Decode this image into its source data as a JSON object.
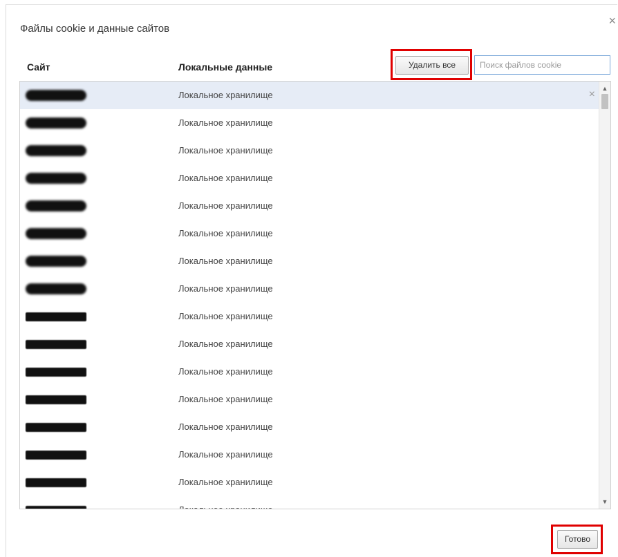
{
  "dialog": {
    "title": "Файлы cookie и данные сайтов",
    "close_glyph": "×"
  },
  "columns": {
    "site": "Сайт",
    "local_data": "Локальные данные"
  },
  "toolbar": {
    "delete_all_label": "Удалить все",
    "search_placeholder": "Поиск файлов cookie"
  },
  "rows": [
    {
      "site": "",
      "local_data": "Локальное хранилище",
      "selected": true
    },
    {
      "site": "",
      "local_data": "Локальное хранилище"
    },
    {
      "site": "",
      "local_data": "Локальное хранилище"
    },
    {
      "site": "",
      "local_data": "Локальное хранилище"
    },
    {
      "site": "",
      "local_data": "Локальное хранилище"
    },
    {
      "site": "",
      "local_data": "Локальное хранилище"
    },
    {
      "site": "",
      "local_data": "Локальное хранилище"
    },
    {
      "site": "",
      "local_data": "Локальное хранилище"
    },
    {
      "site": "",
      "local_data": "Локальное хранилище"
    },
    {
      "site": "",
      "local_data": "Локальное хранилище"
    },
    {
      "site": "",
      "local_data": "Локальное хранилище"
    },
    {
      "site": "",
      "local_data": "Локальное хранилище"
    },
    {
      "site": "",
      "local_data": "Локальное хранилище"
    },
    {
      "site": "",
      "local_data": "Локальное хранилище"
    },
    {
      "site": "",
      "local_data": "Локальное хранилище"
    },
    {
      "site": "",
      "local_data": "Локальное хранилище"
    }
  ],
  "row_remove_glyph": "×",
  "footer": {
    "done_label": "Готово"
  },
  "colors": {
    "highlight": "#e00000",
    "selected_row": "#e6ecf6",
    "search_border": "#7aa7d9"
  }
}
